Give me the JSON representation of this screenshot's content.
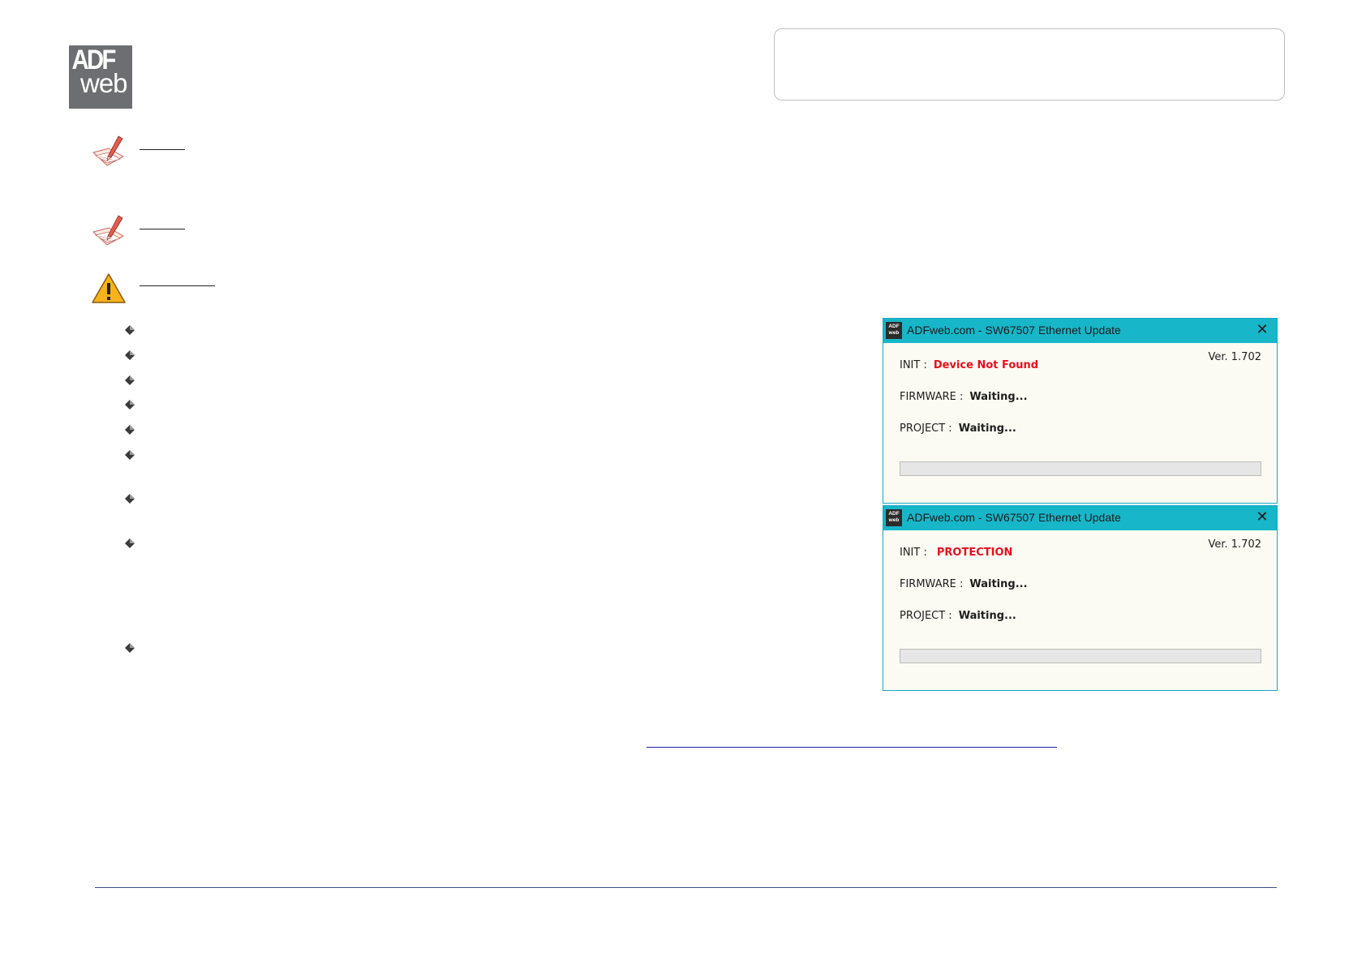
{
  "logo": {
    "line1": "ADF",
    "line2": "web"
  },
  "notes": [
    {
      "icon": "pencil-note-icon"
    },
    {
      "icon": "pencil-note-icon"
    }
  ],
  "warning": {
    "icon": "warning-triangle-icon"
  },
  "bullet_count": 9,
  "dialogs": [
    {
      "title": "ADFweb.com - SW67507 Ethernet Update",
      "app_icon_text": "ADF web",
      "close_glyph": "✕",
      "version": "Ver. 1.702",
      "init_label": "INIT :",
      "init_value": "Device Not Found",
      "firmware_label": "FIRMWARE :",
      "firmware_value": "Waiting...",
      "project_label": "PROJECT :",
      "project_value": "Waiting...",
      "progress": 0
    },
    {
      "title": "ADFweb.com - SW67507 Ethernet Update",
      "app_icon_text": "ADF web",
      "close_glyph": "✕",
      "version": "Ver. 1.702",
      "init_label": "INIT :",
      "init_value": "PROTECTION",
      "firmware_label": "FIRMWARE :",
      "firmware_value": "Waiting...",
      "project_label": "PROJECT :",
      "project_value": "Waiting...",
      "progress": 0
    }
  ],
  "colors": {
    "dialog_titlebar": "#17b6c9",
    "dialog_border": "#17a9c2",
    "dialog_body": "#fbfbf3",
    "error_text": "#e8101c",
    "link": "#1f1fa8",
    "logo_bg": "#6d6e71"
  }
}
